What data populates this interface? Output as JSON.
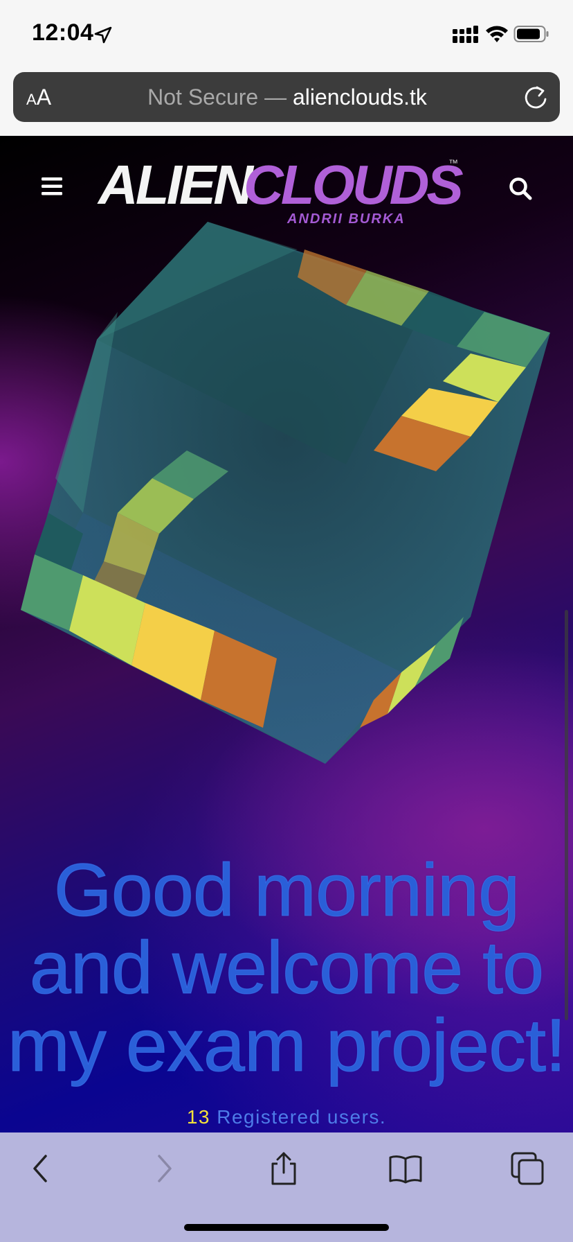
{
  "status_bar": {
    "time": "12:04",
    "icons": [
      "location-arrow-icon",
      "signal-icon",
      "wifi-icon",
      "battery-icon"
    ]
  },
  "address_bar": {
    "reader_label_small": "A",
    "reader_label_large": "A",
    "security_label": "Not Secure —",
    "domain": "alienclouds.tk",
    "reload_icon": "reload-icon"
  },
  "header": {
    "menu_icon": "hamburger-menu-icon",
    "logo_main_white": "ALIEN",
    "logo_main_purple": "CLOUDS",
    "logo_tm": "™",
    "logo_sub": "ANDRII BURKA",
    "search_icon": "search-icon"
  },
  "hero": {
    "headline_line1": "Good morning",
    "headline_line2": "and welcome to",
    "headline_line3": "my exam project!",
    "user_count": "13",
    "user_label": "Registered users."
  },
  "toolbar": {
    "buttons": [
      "back-icon",
      "forward-icon",
      "share-icon",
      "bookmarks-icon",
      "tabs-icon"
    ]
  },
  "colors": {
    "headline": "#2a5fd8",
    "count": "#f3e13a",
    "logo_purple": "#b060d8",
    "toolbar_bg": "#b6b5dd"
  }
}
